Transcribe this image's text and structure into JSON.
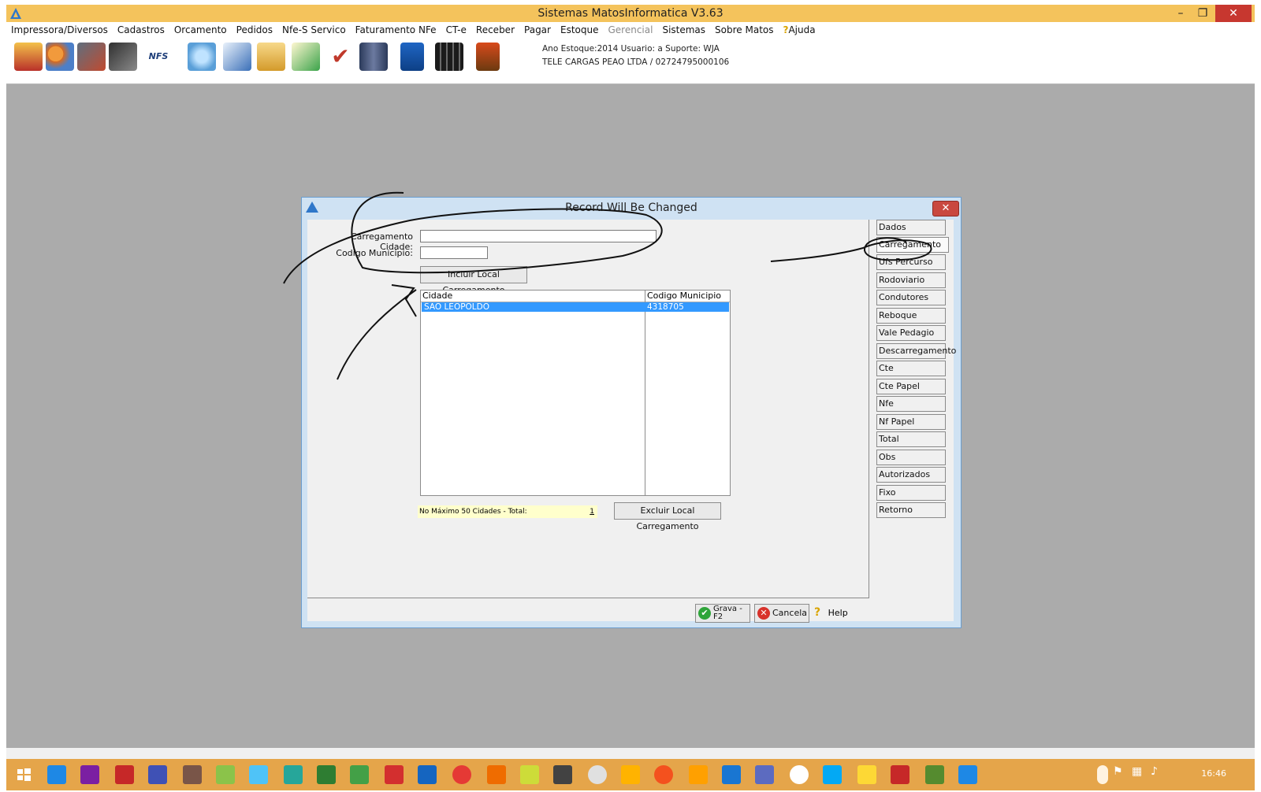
{
  "window": {
    "title": "Sistemas MatosInformatica V3.63",
    "controls": {
      "minimize": "–",
      "restore": "❐",
      "close": "✕"
    }
  },
  "menu": [
    "Impressora/Diversos",
    "Cadastros",
    "Orcamento",
    "Pedidos",
    "Nfe-S Servico",
    "Faturamento NFe",
    "CT-e",
    "Receber",
    "Pagar",
    "Estoque",
    "Gerencial",
    "Sistemas",
    "Sobre Matos",
    "Ajuda"
  ],
  "toolbar": {
    "info_line1": "Ano Estoque:2014 Usuario: a Suporte: WJA",
    "info_line2": "TELE CARGAS PEAO LTDA / 02724795000106",
    "nfse_label": "NFS",
    "icons": [
      "gift-icon",
      "users-icon",
      "truck-icon",
      "printer-icon",
      "nfse-icon",
      "help-link-icon",
      "document-edit-icon",
      "package-icon",
      "envelope-icon",
      "check-icon",
      "tools-icon",
      "save-icon",
      "calculator-icon",
      "exit-icon"
    ]
  },
  "dialog": {
    "title": "Record Will Be Changed",
    "close_label": "✕",
    "form": {
      "cidade_label": "Carregamento Cidade:",
      "cidade_value": "",
      "municipio_label": "Codigo Municipio:",
      "municipio_value": "",
      "incluir_button": "Incluir Local Carregamento"
    },
    "grid": {
      "columns": [
        "Cidade",
        "Codigo Municipio"
      ],
      "rows": [
        {
          "cidade": "SAO LEOPOLDO",
          "codigo": "4318705"
        }
      ]
    },
    "footer": {
      "count_label": "No Máximo 50 Cidades - Total:",
      "count_value": "1",
      "excluir_button": "Excluir Local Carregamento"
    },
    "tabs": [
      "Dados",
      "Carregamento",
      "Ufs Percurso",
      "Rodoviario",
      "Condutores",
      "Reboque",
      "Vale Pedagio",
      "Descarregamento",
      "Cte",
      "Cte Papel",
      "Nfe",
      "Nf Papel",
      "Total",
      "Obs",
      "Autorizados",
      "Fixo",
      "Retorno"
    ],
    "active_tab": "Carregamento",
    "buttons": {
      "grava": "Grava - F2",
      "cancela": "Cancela",
      "help": "Help"
    }
  },
  "taskbar": {
    "clock": "16:46"
  },
  "colors": {
    "titlebar": "#f4c35c",
    "desktop": "#ababab",
    "taskbar": "#e5a54a",
    "selection": "#3399ff",
    "close": "#c7372f"
  }
}
